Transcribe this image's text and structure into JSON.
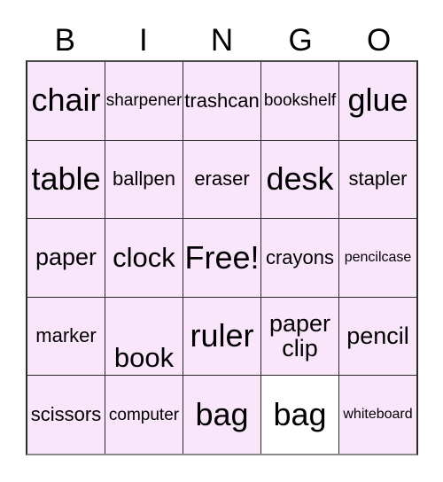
{
  "header": {
    "letters": [
      "B",
      "I",
      "N",
      "G",
      "O"
    ]
  },
  "card": {
    "free_space_label": "Free!",
    "cell_fill_color": "#fae6fa",
    "free_cell_color": "#fae6fa",
    "marked_cell_color": "#ffffff",
    "border_color": "#2b2b2b",
    "text_color": "#000000"
  },
  "grid": {
    "columns": 5,
    "rows": 5,
    "cells": [
      {
        "text": "chair",
        "size": "fs-xxl",
        "marked": false,
        "align": "center"
      },
      {
        "text": "sharpener",
        "size": "fs-sm",
        "marked": false,
        "align": "center"
      },
      {
        "text": "trashcan",
        "size": "fs-md",
        "marked": false,
        "align": "center"
      },
      {
        "text": "bookshelf",
        "size": "fs-sm",
        "marked": false,
        "align": "center"
      },
      {
        "text": "glue",
        "size": "fs-xxl",
        "marked": false,
        "align": "center"
      },
      {
        "text": "table",
        "size": "fs-xxl",
        "marked": false,
        "align": "center"
      },
      {
        "text": "ballpen",
        "size": "fs-md",
        "marked": false,
        "align": "center"
      },
      {
        "text": "eraser",
        "size": "fs-md",
        "marked": false,
        "align": "center"
      },
      {
        "text": "desk",
        "size": "fs-xxl",
        "marked": false,
        "align": "center"
      },
      {
        "text": "stapler",
        "size": "fs-md",
        "marked": false,
        "align": "center"
      },
      {
        "text": "paper",
        "size": "fs-lg",
        "marked": false,
        "align": "center"
      },
      {
        "text": "clock",
        "size": "fs-xl",
        "marked": false,
        "align": "center"
      },
      {
        "text": "Free!",
        "size": "fs-xxl",
        "marked": false,
        "align": "center"
      },
      {
        "text": "crayons",
        "size": "fs-md",
        "marked": false,
        "align": "center"
      },
      {
        "text": "pencilcase",
        "size": "fs-xs",
        "marked": false,
        "align": "center"
      },
      {
        "text": "marker",
        "size": "fs-md",
        "marked": false,
        "align": "center"
      },
      {
        "text": "book",
        "size": "fs-xl",
        "marked": false,
        "align": "bottom"
      },
      {
        "text": "ruler",
        "size": "fs-xxl",
        "marked": false,
        "align": "center"
      },
      {
        "text": "paper\nclip",
        "size": "fs-lg",
        "marked": false,
        "align": "center"
      },
      {
        "text": "pencil",
        "size": "fs-lg",
        "marked": false,
        "align": "center"
      },
      {
        "text": "scissors",
        "size": "fs-md",
        "marked": false,
        "align": "center"
      },
      {
        "text": "computer",
        "size": "fs-sm",
        "marked": false,
        "align": "center"
      },
      {
        "text": "bag",
        "size": "fs-xxl",
        "marked": false,
        "align": "center"
      },
      {
        "text": "bag",
        "size": "fs-xxl",
        "marked": true,
        "align": "center"
      },
      {
        "text": "whiteboard",
        "size": "fs-xs",
        "marked": false,
        "align": "center"
      }
    ]
  }
}
